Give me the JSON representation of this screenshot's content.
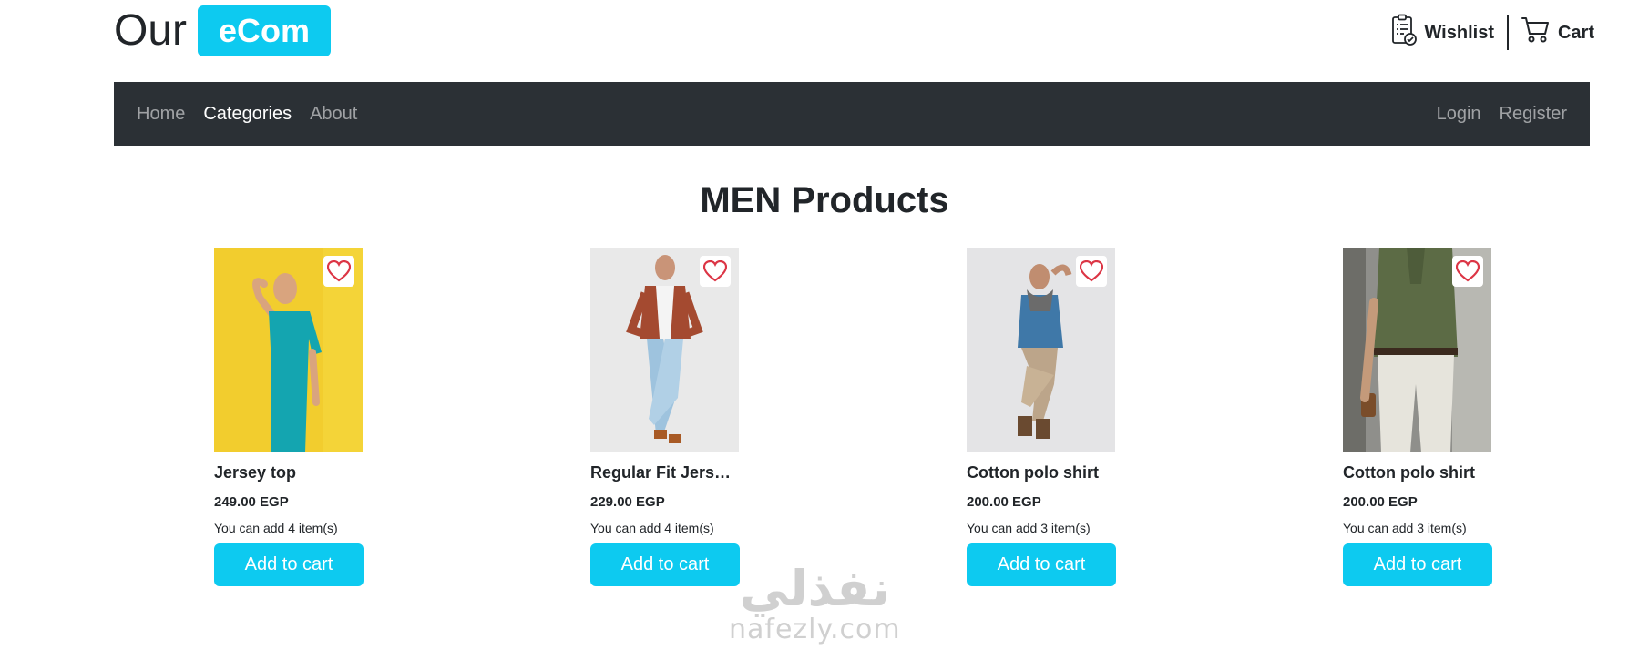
{
  "header": {
    "logo_text": "Our",
    "logo_badge": "eCom",
    "wishlist_label": "Wishlist",
    "cart_label": "Cart"
  },
  "nav": {
    "left": [
      {
        "label": "Home",
        "active": false
      },
      {
        "label": "Categories",
        "active": true
      },
      {
        "label": "About",
        "active": false
      }
    ],
    "right": [
      {
        "label": "Login"
      },
      {
        "label": "Register"
      }
    ]
  },
  "page_title": "MEN Products",
  "products": [
    {
      "name": "Jersey top",
      "price": "249.00 EGP",
      "stock": "You can add 4 item(s)",
      "button": "Add to cart",
      "image": "man-teal-shirt-yellow-bg"
    },
    {
      "name": "Regular Fit Jersey shirt",
      "price": "229.00 EGP",
      "stock": "You can add 4 item(s)",
      "button": "Add to cart",
      "image": "man-plaid-shirt-jeans"
    },
    {
      "name": "Cotton polo shirt",
      "price": "200.00 EGP",
      "stock": "You can add 3 item(s)",
      "button": "Add to cart",
      "image": "man-denim-shirt-scarf"
    },
    {
      "name": "Cotton polo shirt",
      "price": "200.00 EGP",
      "stock": "You can add 3 item(s)",
      "button": "Add to cart",
      "image": "man-olive-polo-white-pants"
    }
  ],
  "watermark": {
    "arabic": "نفذلي",
    "latin": "nafezly.com"
  },
  "colors": {
    "accent": "#0dcaf0",
    "navbar": "#2b3035",
    "heart": "#dc3545"
  }
}
